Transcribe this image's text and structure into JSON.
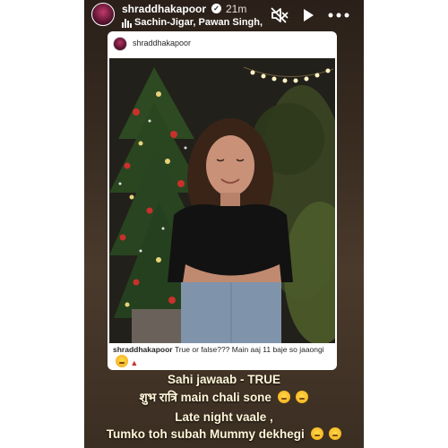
{
  "header": {
    "username": "shraddhakapoor",
    "time": "21m",
    "music": "Sachin-Jigar, Pawan Singh,"
  },
  "card": {
    "username": "shraddhakapoor",
    "caption_user": "shraddhakapoor",
    "caption_text": "True or false??? Main aaj 11 baje so jaaongi"
  },
  "overlay": {
    "line1": "Sahi jawaab - TRUE",
    "line2_hindi": "शुभ रात्रि",
    "line2_rest": "main chali sone",
    "line3": "Late night vaale ,",
    "line4": "Tumko toh subah Mummy dekhegi"
  }
}
